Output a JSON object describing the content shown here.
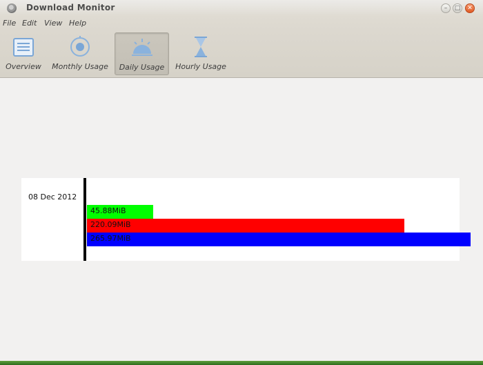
{
  "window": {
    "title": "Download Monitor",
    "close_glyph": "✕",
    "max_glyph": "□",
    "min_glyph": "–"
  },
  "menu": [
    "File",
    "Edit",
    "View",
    "Help"
  ],
  "toolbar": [
    {
      "label": "Overview",
      "icon": "overview-icon",
      "active": false
    },
    {
      "label": "Monthly Usage",
      "icon": "monthly-usage-icon",
      "active": false
    },
    {
      "label": "Daily Usage",
      "icon": "daily-usage-icon",
      "active": true
    },
    {
      "label": "Hourly Usage",
      "icon": "hourly-usage-icon",
      "active": false
    }
  ],
  "chart_data": {
    "type": "bar",
    "orientation": "horizontal",
    "categories": [
      "08 Dec 2012"
    ],
    "unit": "MiB",
    "max_value": 265.97,
    "series": [
      {
        "values": [
          45.88
        ],
        "label": "45.88MiB",
        "color": "#00ff00"
      },
      {
        "values": [
          220.09
        ],
        "label": "220.09MiB",
        "color": "#ff0000"
      },
      {
        "values": [
          265.97
        ],
        "label": "265.97MiB",
        "color": "#0000ff"
      }
    ]
  },
  "colors": {
    "window_bg": "#f2f1f0",
    "toolbar_bg": "#d8d4cb",
    "close_button": "#e9652d",
    "icon_blue": "#8ab2dd"
  }
}
